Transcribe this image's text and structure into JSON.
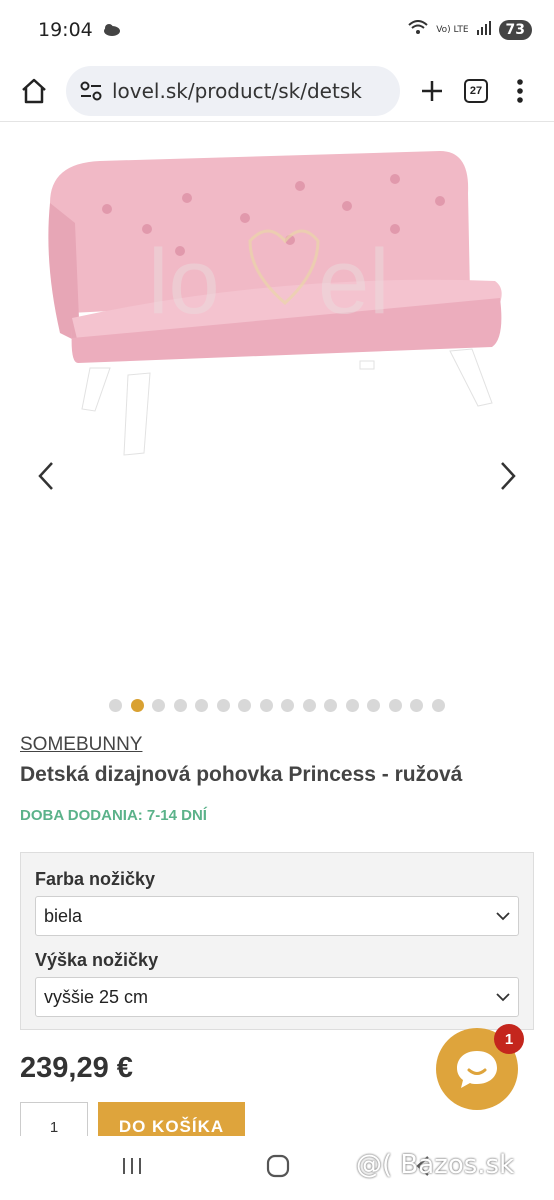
{
  "status": {
    "time": "19:04",
    "net_label": "Vo) LTE",
    "battery": "73"
  },
  "browser": {
    "url": "lovel.sk/product/sk/detsk",
    "tab_count": "27"
  },
  "gallery": {
    "dot_count": 16,
    "active_index": 1
  },
  "product": {
    "brand": "SOMEBUNNY",
    "title": "Detská dizajnová pohovka Princess - ružová",
    "delivery": "DOBA DODANIA: 7-14 DNÍ",
    "price": "239,29  €"
  },
  "options": {
    "leg_color_label": "Farba nožičky",
    "leg_color_value": "biela",
    "leg_height_label": "Výška nožičky",
    "leg_height_value": "vyššie 25 cm"
  },
  "cart": {
    "qty": "1",
    "button": "DO KOŠÍKA"
  },
  "chat": {
    "badge": "1"
  },
  "watermark": "@( Bazos.sk"
}
